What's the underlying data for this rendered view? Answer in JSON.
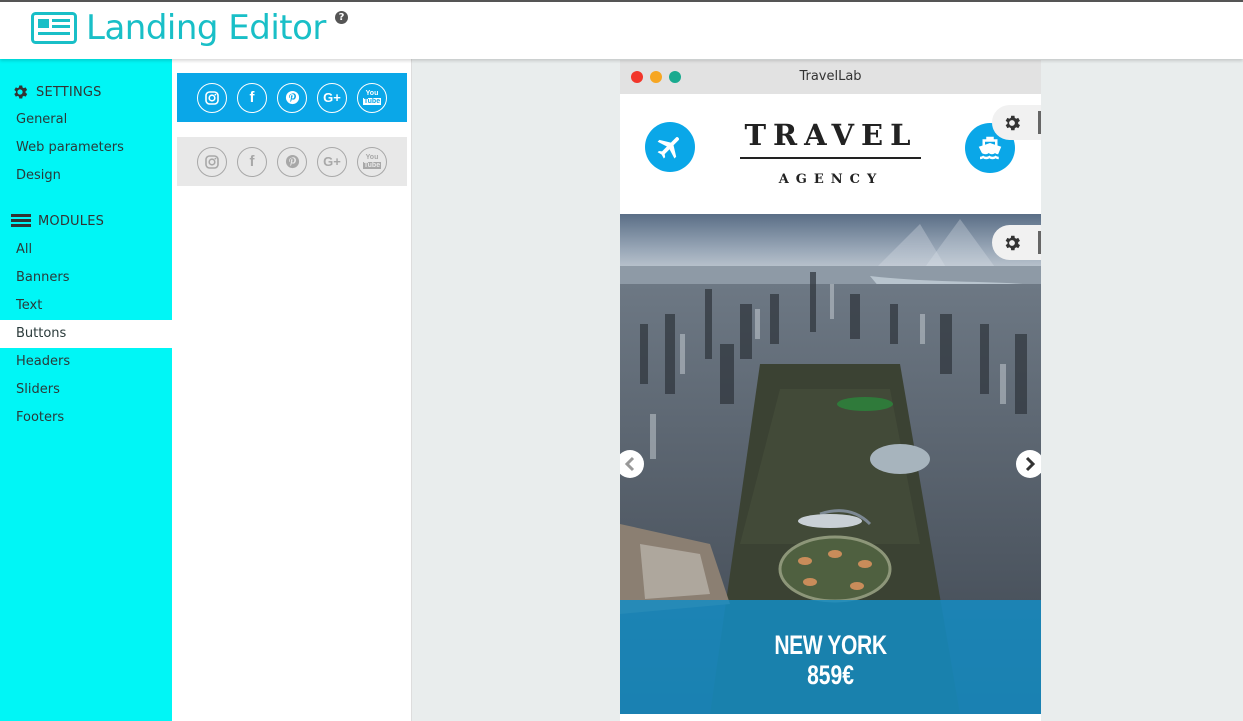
{
  "app": {
    "title": "Landing Editor",
    "help": "?"
  },
  "sidebar": {
    "settings_label": "SETTINGS",
    "settings_items": [
      "General",
      "Web parameters",
      "Design"
    ],
    "modules_label": "MODULES",
    "module_items": [
      "All",
      "Banners",
      "Text",
      "Buttons",
      "Headers",
      "Sliders",
      "Footers"
    ],
    "active_item": "Buttons"
  },
  "panel": {
    "buttons_rows": [
      {
        "style": "blue",
        "icons": [
          "instagram-icon",
          "facebook-icon",
          "pinterest-icon",
          "google-plus-icon",
          "youtube-icon"
        ]
      },
      {
        "style": "grey",
        "icons": [
          "instagram-icon",
          "facebook-icon",
          "pinterest-icon",
          "google-plus-icon",
          "youtube-icon"
        ]
      }
    ],
    "glyphs": {
      "facebook": "f",
      "google_plus": "G+",
      "youtube_top": "You",
      "youtube_bottom": "Tube"
    }
  },
  "preview": {
    "window_title": "TravelLab",
    "brand_main": "TRAVEL",
    "brand_sub": "AGENCY",
    "slide_city": "NEW YORK",
    "slide_price": "859€"
  },
  "colors": {
    "accent": "#19bfc7",
    "sidebar": "#00f6f6",
    "blue": "#0aa7e8",
    "dot_red": "#f2362b",
    "dot_orange": "#f6a623",
    "dot_green": "#1aaa8f"
  }
}
